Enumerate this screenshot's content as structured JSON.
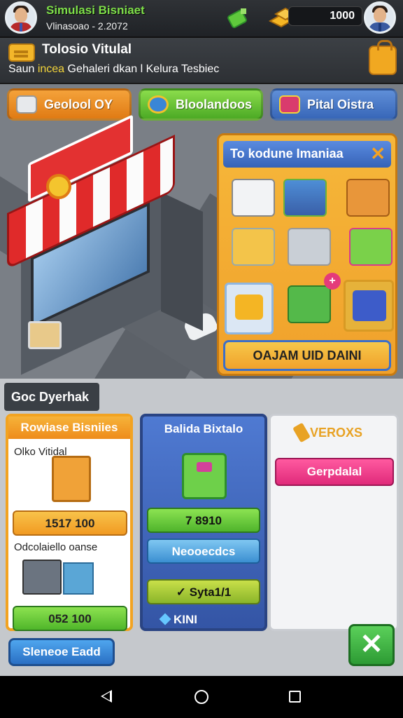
{
  "topbar": {
    "title": "Simulasi Bisniaet",
    "subtitle": "Vlinasoao - 2.2072",
    "coins": "1000",
    "avatar_left_icon": "avatar-businessman",
    "avatar_right_icon": "avatar-businessman",
    "shortcut_icon": "green-cart-icon",
    "coin_icon": "gold-bars-icon"
  },
  "header": {
    "title": "Tolosio Vitulal",
    "desc_start": "Saun ",
    "desc_highlight": "incea",
    "desc_end": " Gehaleri dkan l Kelura Tesbiec",
    "icon": "ticket-icon",
    "bag_icon": "shopping-bag-icon"
  },
  "tabs": [
    {
      "label": "Geolool OY",
      "icon": "box-icon"
    },
    {
      "label": "Bloolandoos",
      "icon": "globe-icon"
    },
    {
      "label": "Pital Oistra",
      "icon": "gift-icon"
    }
  ],
  "shop": {
    "title": "To kodune Imaniaa",
    "close": "✕",
    "button": "OAJAM UID DAINI",
    "items": [
      "truck-icon",
      "belt-icon",
      "box-icon",
      "cart-icon",
      "cart-icon",
      "gift-icon",
      "cart-icon",
      "crate-icon",
      "crate-icon"
    ],
    "plus": "+"
  },
  "section_title": "Goc Dyerhak",
  "card1": {
    "title": "Rowiase Bisniies",
    "label1": "Olko Vitidal",
    "price1": "1517 100",
    "label2": "Odcolaiello oanse",
    "price2": "052 100"
  },
  "card2": {
    "title": "Balida Bixtalo",
    "btn1": "7 8910",
    "btn2": "Neooecdcs",
    "btn3": "✓ Syta1/1",
    "kini": "KINI"
  },
  "card3": {
    "promo": "VEROXS",
    "button": "Gerpdalal"
  },
  "bottom_btn": "Sleneoe Eadd",
  "close_icon": "✕"
}
